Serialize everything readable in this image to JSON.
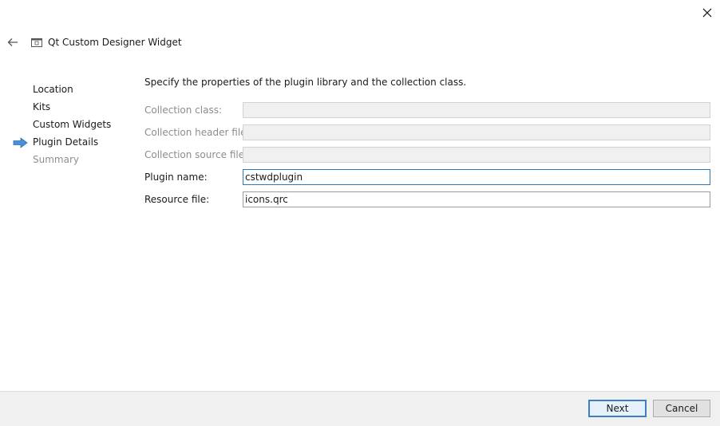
{
  "window": {
    "title": "Qt Custom Designer Widget",
    "close_icon": "close-icon",
    "back_icon": "back-arrow-icon"
  },
  "steps": [
    {
      "label": "Location",
      "state": "done"
    },
    {
      "label": "Kits",
      "state": "done"
    },
    {
      "label": "Custom Widgets",
      "state": "done"
    },
    {
      "label": "Plugin Details",
      "state": "current"
    },
    {
      "label": "Summary",
      "state": "pending"
    }
  ],
  "main": {
    "intro": "Specify the properties of the plugin library and the collection class.",
    "fields": [
      {
        "label": "Collection class:",
        "value": "",
        "enabled": false
      },
      {
        "label": "Collection header file:",
        "value": "",
        "enabled": false
      },
      {
        "label": "Collection source file:",
        "value": "",
        "enabled": false
      },
      {
        "label": "Plugin name:",
        "value": "cstwdplugin",
        "enabled": true,
        "focused": true
      },
      {
        "label": "Resource file:",
        "value": "icons.qrc",
        "enabled": true
      }
    ]
  },
  "footer": {
    "next_label": "Next",
    "cancel_label": "Cancel"
  },
  "colors": {
    "accent": "#3c7fc4",
    "current_step_arrow": "#4a90d9",
    "disabled_text": "#8c8c8c"
  }
}
